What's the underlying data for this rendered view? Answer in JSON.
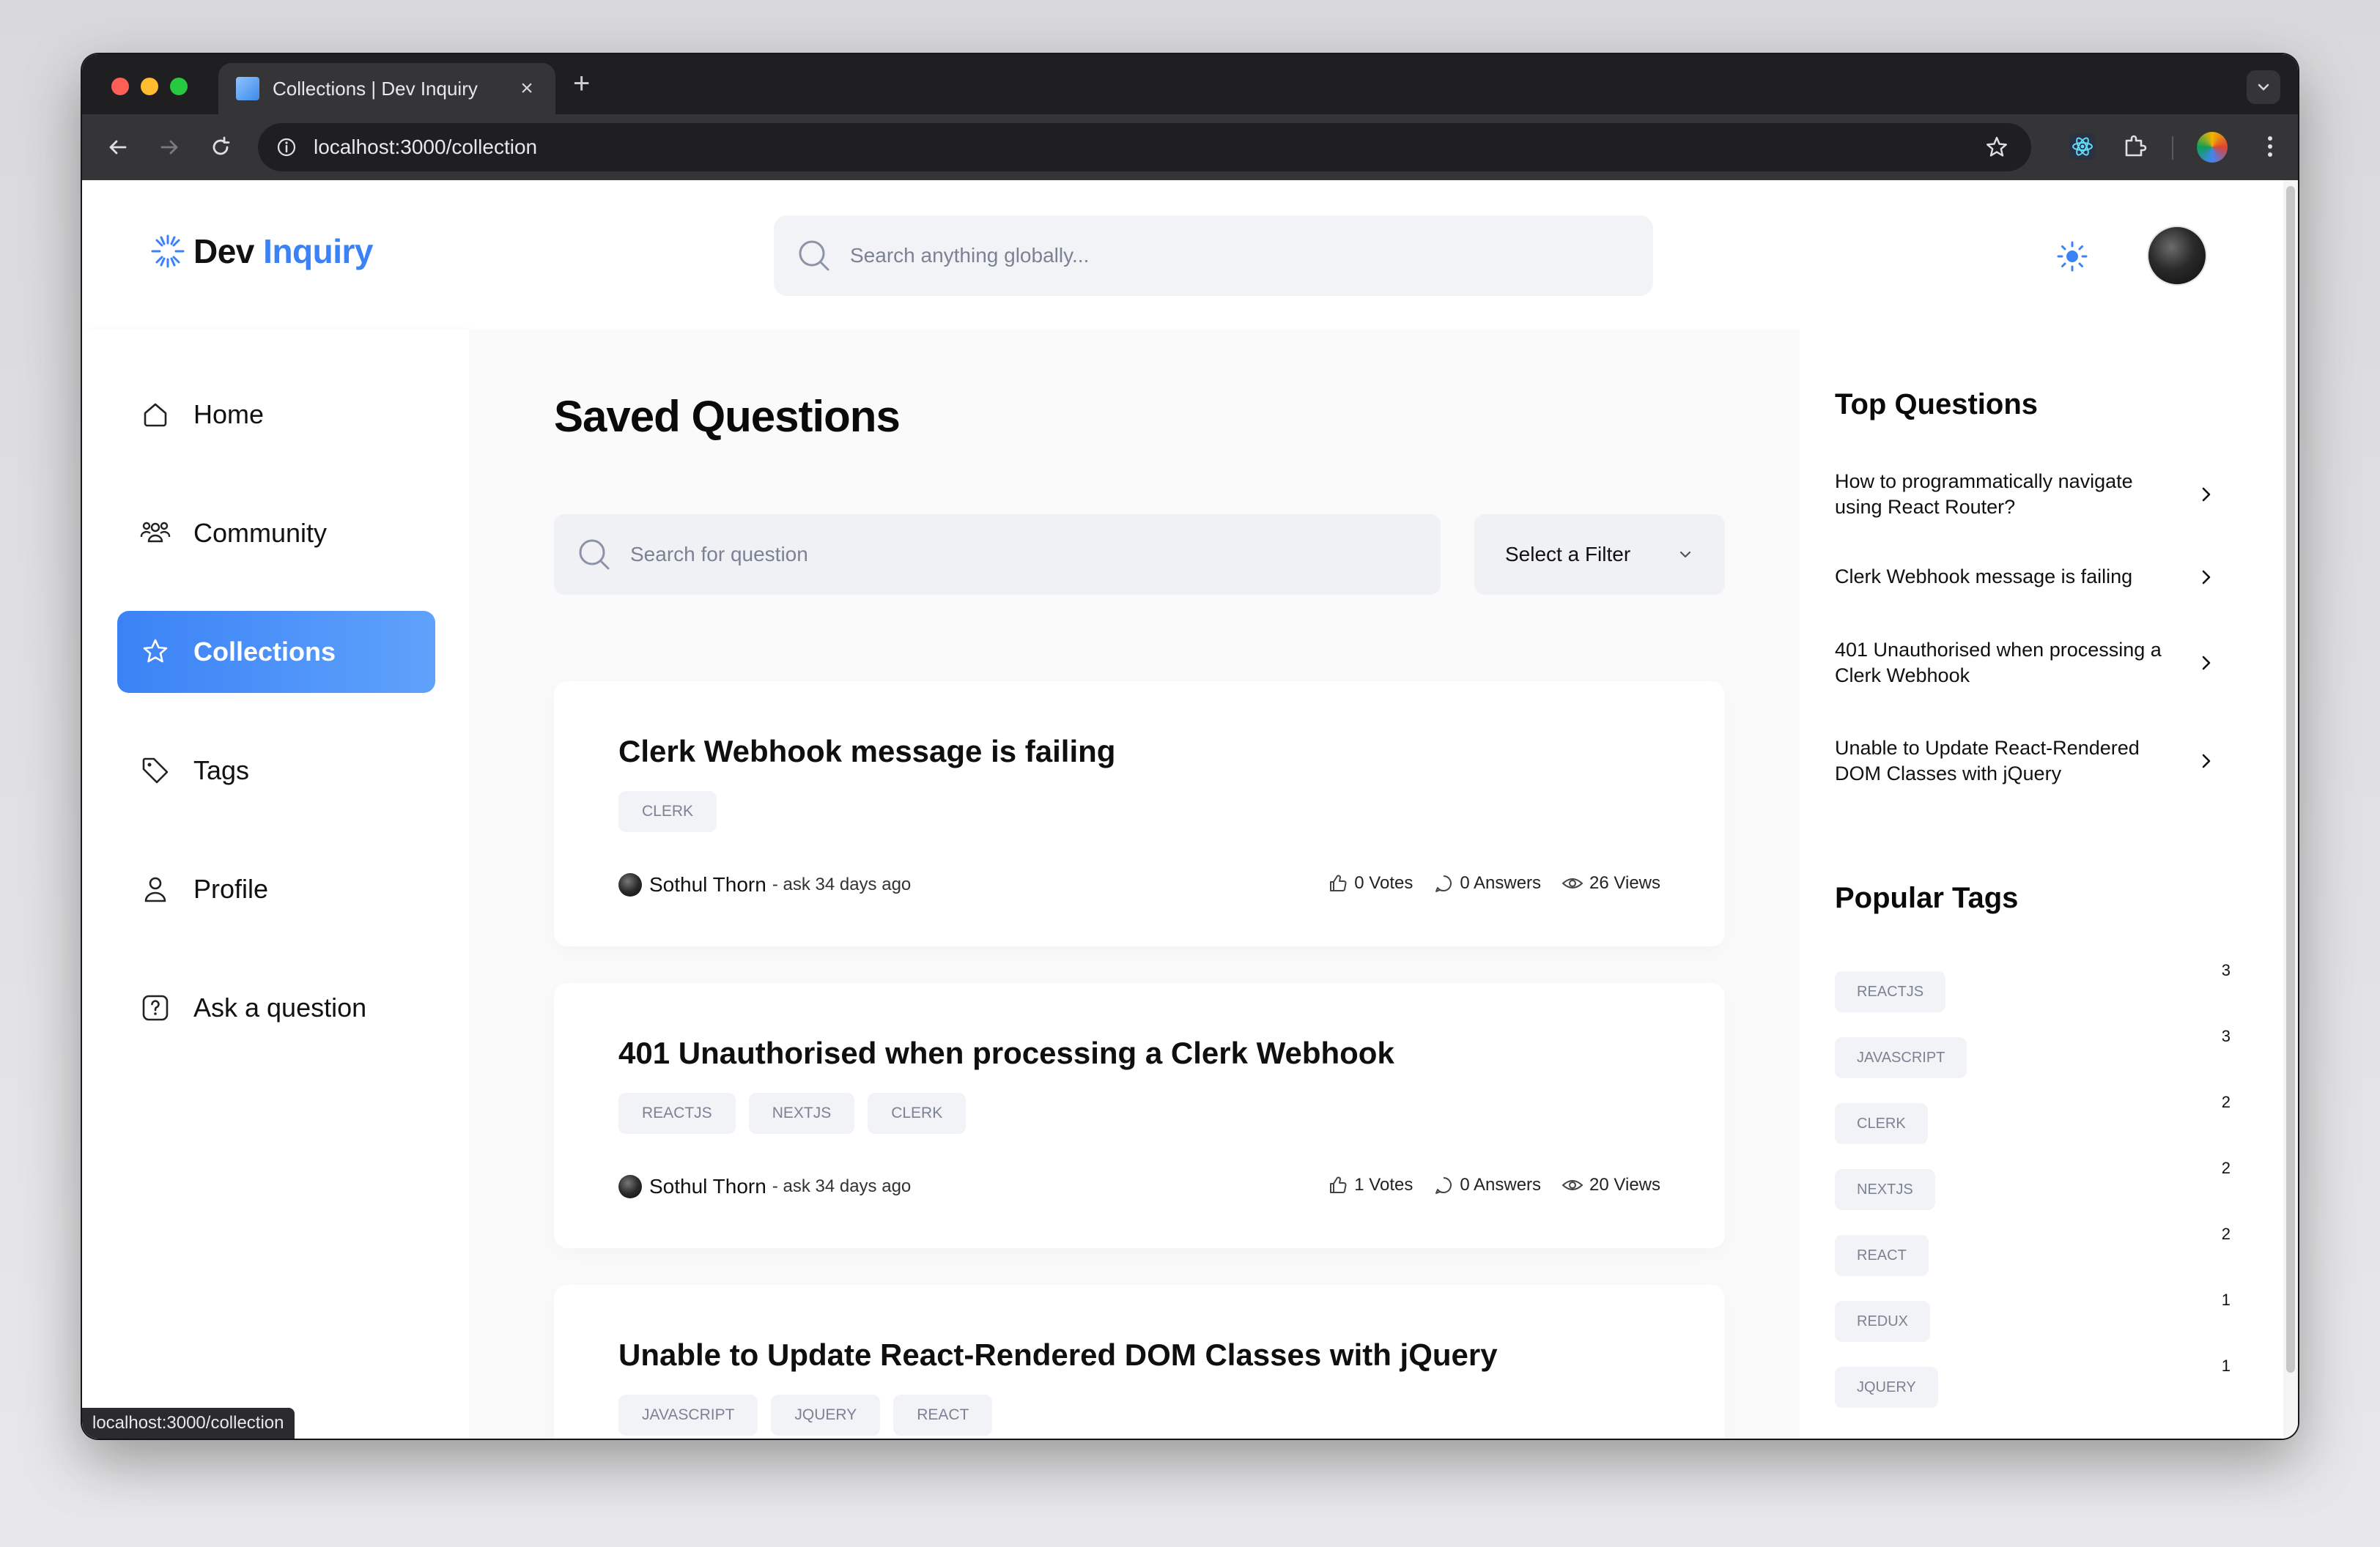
{
  "browser": {
    "tab_title": "Collections | Dev Inquiry",
    "url": "localhost:3000/collection",
    "status_url": "localhost:3000/collection"
  },
  "header": {
    "logo_dev": "Dev",
    "logo_inquiry": "Inquiry",
    "search_placeholder": "Search anything globally..."
  },
  "sidebar": {
    "items": [
      {
        "label": "Home",
        "icon": "home-icon"
      },
      {
        "label": "Community",
        "icon": "users-icon"
      },
      {
        "label": "Collections",
        "icon": "star-icon",
        "active": true
      },
      {
        "label": "Tags",
        "icon": "tag-icon"
      },
      {
        "label": "Profile",
        "icon": "user-icon"
      },
      {
        "label": "Ask a question",
        "icon": "question-icon"
      }
    ]
  },
  "main": {
    "title": "Saved Questions",
    "search_placeholder": "Search for question",
    "filter_label": "Select a Filter",
    "questions": [
      {
        "title": "Clerk Webhook message is failing",
        "tags": [
          "CLERK"
        ],
        "author": "Sothul Thorn",
        "asked": "- ask 34 days ago",
        "votes": "0 Votes",
        "answers": "0 Answers",
        "views": "26 Views"
      },
      {
        "title": "401 Unauthorised when processing a Clerk Webhook",
        "tags": [
          "REACTJS",
          "NEXTJS",
          "CLERK"
        ],
        "author": "Sothul Thorn",
        "asked": "- ask 34 days ago",
        "votes": "1 Votes",
        "answers": "0 Answers",
        "views": "20 Views"
      },
      {
        "title": "Unable to Update React-Rendered DOM Classes with jQuery",
        "tags": [
          "JAVASCRIPT",
          "JQUERY",
          "REACT"
        ]
      }
    ]
  },
  "rightbar": {
    "top_questions_heading": "Top Questions",
    "top_questions": [
      "How to programmatically navigate using React Router?",
      "Clerk Webhook message is failing",
      "401 Unauthorised when processing a Clerk Webhook",
      "Unable to Update React-Rendered DOM Classes with jQuery"
    ],
    "popular_tags_heading": "Popular Tags",
    "popular_tags": [
      {
        "name": "REACTJS",
        "count": "3"
      },
      {
        "name": "JAVASCRIPT",
        "count": "3"
      },
      {
        "name": "CLERK",
        "count": "2"
      },
      {
        "name": "NEXTJS",
        "count": "2"
      },
      {
        "name": "REACT",
        "count": "2"
      },
      {
        "name": "REDUX",
        "count": "1"
      },
      {
        "name": "JQUERY",
        "count": "1"
      }
    ]
  },
  "colors": {
    "accent": "#3b82f6",
    "traffic_red": "#fe5f57",
    "traffic_yellow": "#febc2e",
    "traffic_green": "#28c840"
  }
}
